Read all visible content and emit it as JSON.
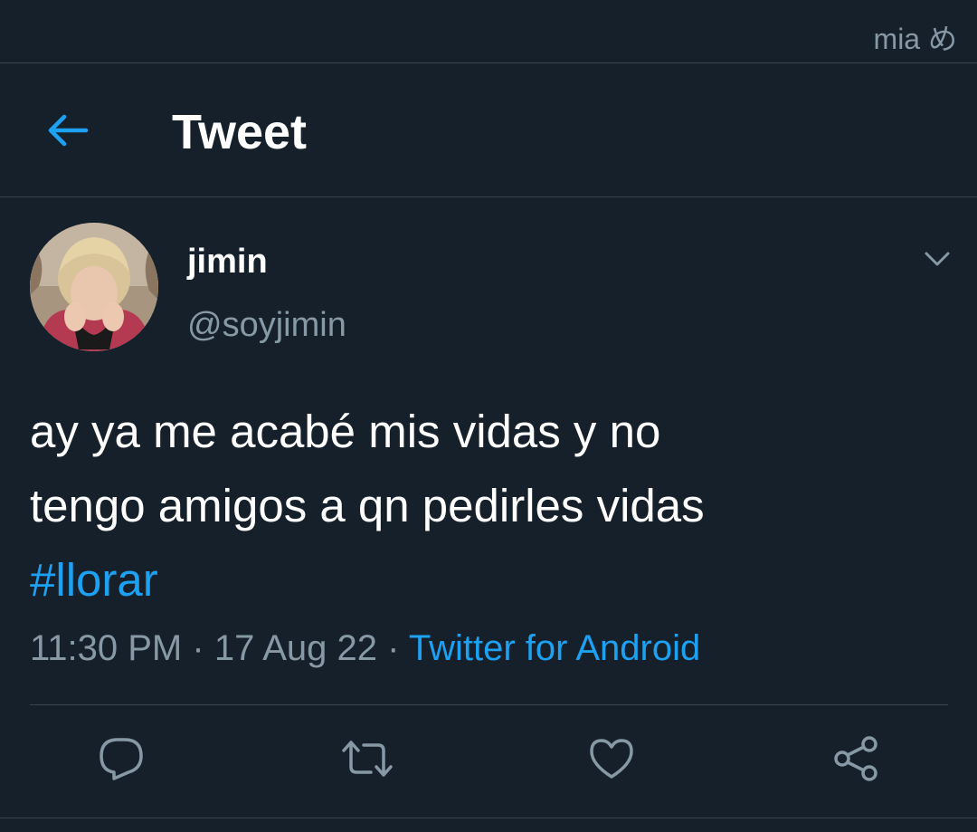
{
  "watermark": "mia め",
  "header": {
    "back_icon": "arrow-left-icon",
    "title": "Tweet"
  },
  "tweet": {
    "author": {
      "display_name": "jimin",
      "handle": "@soyjimin"
    },
    "caret_icon": "chevron-down-icon",
    "text_lines": [
      "ay ya me acabé mis vidas y no",
      "tengo amigos a qn pedirles vidas"
    ],
    "hashtag": "#llorar",
    "time": "11:30 PM",
    "separator": "·",
    "date": "17 Aug 22",
    "source": "Twitter for Android",
    "actions": {
      "reply_icon": "reply-icon",
      "retweet_icon": "retweet-icon",
      "like_icon": "heart-icon",
      "share_icon": "share-icon"
    }
  },
  "colors": {
    "background": "#15202b",
    "accent": "#1da1f2",
    "secondary_text": "#8899a6",
    "divider": "#38444d"
  }
}
